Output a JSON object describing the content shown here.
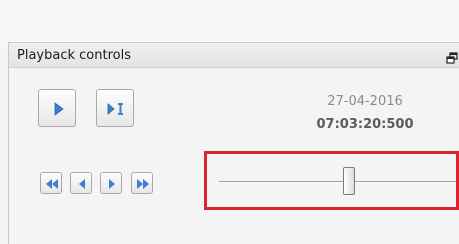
{
  "panel": {
    "title": "Playback controls",
    "float_icon": "restore-window-icon"
  },
  "buttons": {
    "play": "play-icon",
    "step_frame": "step-frame-icon",
    "rewind": "rewind-icon",
    "step_back": "step-back-icon",
    "step_forward": "step-forward-icon",
    "fast_forward": "fast-forward-icon"
  },
  "info": {
    "date": "27-04-2016",
    "time": "07:03:20:500"
  },
  "slider": {
    "position_fraction": 0.55,
    "highlight_color": "#d9252b"
  },
  "colors": {
    "icon_blue": "#3f7fd0"
  }
}
